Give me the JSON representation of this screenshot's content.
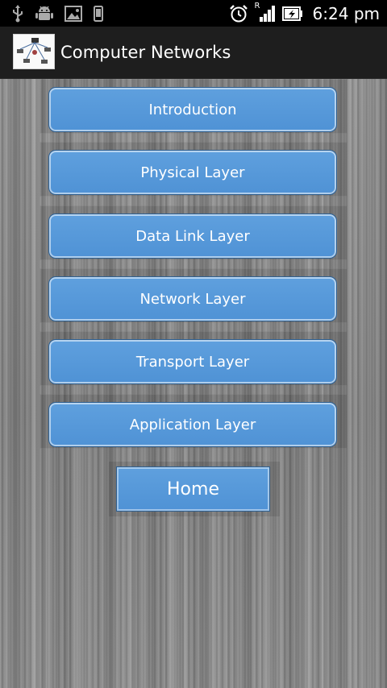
{
  "status_bar": {
    "time": "6:24 pm",
    "left_icons": [
      "usb-icon",
      "android-icon",
      "image-icon",
      "phone-icon"
    ],
    "right_icons": [
      "alarm-clock-icon",
      "signal-icon",
      "battery-icon"
    ],
    "roaming_indicator": "R"
  },
  "action_bar": {
    "title": "Computer Networks",
    "icon": "network-diagram-icon"
  },
  "menu": {
    "items": [
      {
        "label": "Introduction"
      },
      {
        "label": "Physical Layer"
      },
      {
        "label": "Data Link Layer"
      },
      {
        "label": "Network Layer"
      },
      {
        "label": "Transport Layer"
      },
      {
        "label": "Application Layer"
      }
    ],
    "home_label": "Home"
  },
  "colors": {
    "button_fill": "#5599dc",
    "button_border": "#2f5f8f",
    "status_bar": "#000000",
    "action_bar": "#1e1e1e",
    "background": "#8d8d8d"
  }
}
